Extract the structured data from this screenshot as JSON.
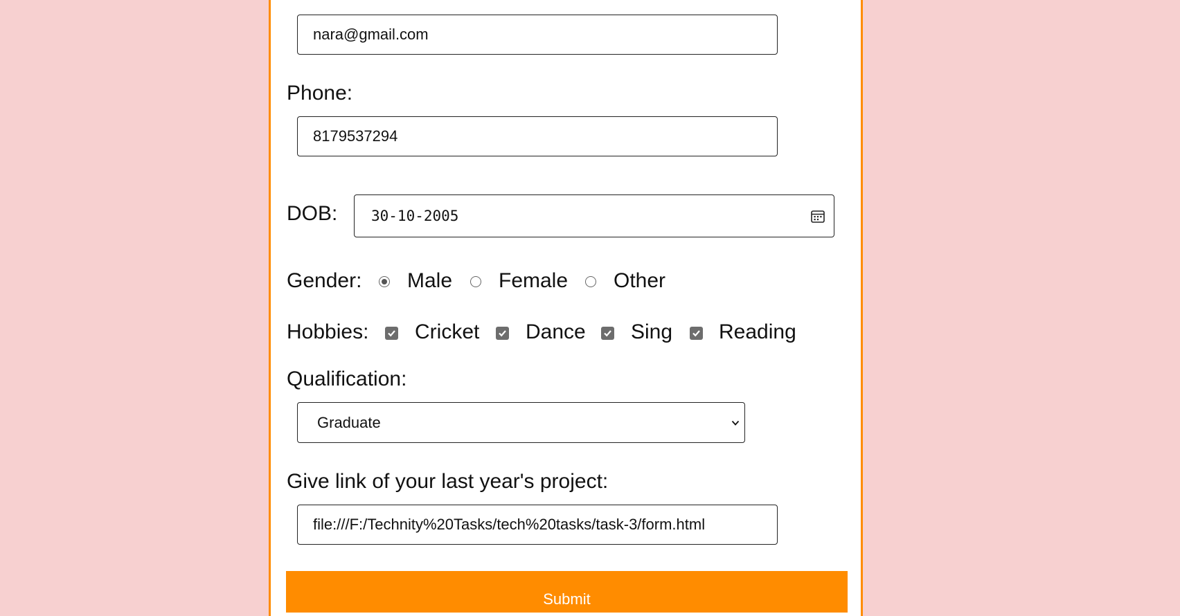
{
  "form": {
    "email": {
      "value": "nara@gmail.com"
    },
    "phone": {
      "label": "Phone:",
      "value": "8179537294"
    },
    "dob": {
      "label": "DOB:",
      "value": "30-10-2005",
      "icon": "calendar-icon"
    },
    "gender": {
      "label": "Gender:",
      "options": [
        {
          "label": "Male",
          "checked": true
        },
        {
          "label": "Female",
          "checked": false
        },
        {
          "label": "Other",
          "checked": false
        }
      ]
    },
    "hobbies": {
      "label": "Hobbies:",
      "options": [
        {
          "label": "Cricket",
          "checked": true
        },
        {
          "label": "Dance",
          "checked": true
        },
        {
          "label": "Sing",
          "checked": true
        },
        {
          "label": "Reading",
          "checked": true
        }
      ]
    },
    "qualification": {
      "label": "Qualification:",
      "selected": "Graduate"
    },
    "project": {
      "label": "Give link of your last year's project:",
      "value": "file:///F:/Technity%20Tasks/tech%20tasks/task-3/form.html"
    },
    "submit_label": "Submit"
  },
  "colors": {
    "page_background": "#f7d0d0",
    "accent": "#ff8c00",
    "card": "#ffffff"
  }
}
